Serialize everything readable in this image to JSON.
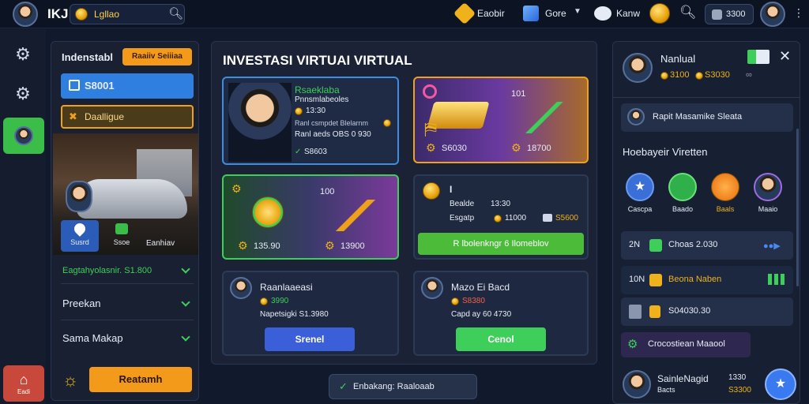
{
  "topbar": {
    "logo": "IKJ",
    "search_text": "Lgllao",
    "nav": [
      {
        "label": "Eaobir",
        "icon": "gear-badge-icon"
      },
      {
        "label": "Gore",
        "icon": "cube-icon"
      },
      {
        "label": "Kanw",
        "icon": "chat-icon"
      }
    ],
    "balance": "3300"
  },
  "left": {
    "title": "Indenstabl",
    "badge": "Raaiiv Seiiiaa",
    "value_button": "S8001",
    "alt_button": "Daalligue",
    "tabs": [
      "Susrd",
      "Ssoe",
      "Eanhiav"
    ],
    "stat_line": "Eagtahyolasnir. S1.800",
    "menu": [
      "Preekan",
      "Sama Makap"
    ],
    "action_button": "Reatamh",
    "rail_bottom_label": "Eadi"
  },
  "main": {
    "title": "INVESTASI VIRTUAI VIRTUAL",
    "profile_card": {
      "name": "Rsaeklaba",
      "subtitle": "Pnnsmlabeoles",
      "coin_value": "13:30",
      "line": "Ranl csmpdet Blelarnm",
      "line2": "Ranl aeds OBS 0 930",
      "value": "S8603"
    },
    "gold_card": {
      "top": "101",
      "left_value": "S6030",
      "right_value": "18700"
    },
    "coin_card": {
      "top": "100",
      "left_value": "135.90",
      "right_value": "13900"
    },
    "wallet_card": {
      "title": "I",
      "line1_label": "Bealde",
      "line1_value": "13:30",
      "line2_label": "Esgatp",
      "line2_value": "11000",
      "line3_value": "S5600",
      "button": "R lbolenkngr 6 Ilomeblov"
    },
    "invest_card_1": {
      "name": "Raanlaaeasi",
      "coin": "3990",
      "line": "Napetsigki S1.3980",
      "button": "Srenel"
    },
    "invest_card_2": {
      "name": "Mazo Ei Bacd",
      "coin": "S8380",
      "line": "Capd ay 60 4730",
      "button": "Cenol"
    },
    "footer_pill": "Enbakang: Raaloaab"
  },
  "right": {
    "user_name": "Nanlual",
    "user_coin": "3100",
    "user_value": "S3030",
    "notice": "Rapit Masamike Sleata",
    "section_title": "Hoebayeir Viretten",
    "quick": [
      {
        "label": "Cascpa",
        "icon": "star-icon",
        "color": "#3a6fd8"
      },
      {
        "label": "Baado",
        "icon": "chat-bubble-icon",
        "color": "#2fb04a"
      },
      {
        "label": "Baals",
        "icon": "coin-icon",
        "color": "#f08a1c"
      },
      {
        "label": "Maaio",
        "icon": "avatar-icon",
        "color": "#7a3fc0"
      }
    ],
    "rows": [
      {
        "prefix": "2N",
        "text": "Choas 2.030"
      },
      {
        "prefix": "10N",
        "text": "Beona Naben"
      },
      {
        "prefix": "",
        "text": "S04030.30"
      }
    ],
    "chip": "Crocostiean Maaool",
    "bottom_user": {
      "name": "SainleNagid",
      "sub": "Bacts",
      "v1": "1330",
      "v2": "S3300"
    }
  }
}
